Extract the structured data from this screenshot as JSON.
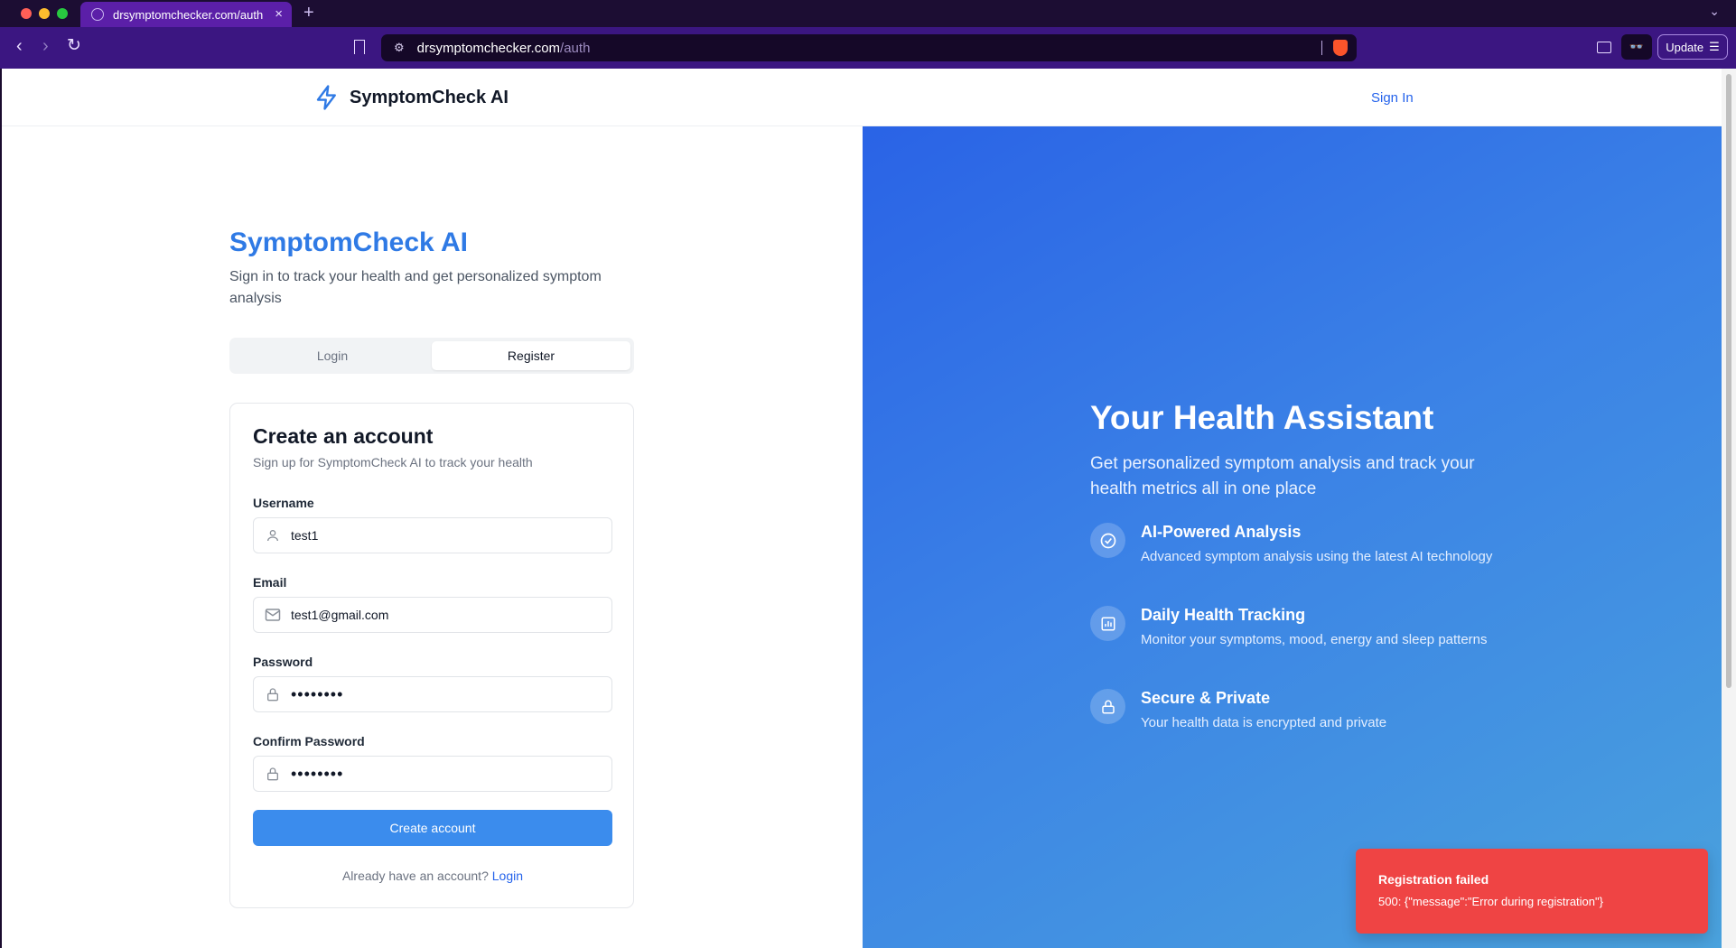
{
  "browser": {
    "tab_title": "drsymptomchecker.com/auth",
    "url_host": "drsymptomchecker.com",
    "url_path": "/auth",
    "update_label": "Update"
  },
  "header": {
    "brand_name": "SymptomCheck AI",
    "sign_in_label": "Sign In"
  },
  "hero": {
    "title": "SymptomCheck AI",
    "subtitle": "Sign in to track your health and get personalized symptom analysis"
  },
  "tabs": {
    "login_label": "Login",
    "register_label": "Register",
    "active": "Register"
  },
  "form": {
    "title": "Create an account",
    "subtitle": "Sign up for SymptomCheck AI to track your health",
    "username_label": "Username",
    "username_value": "test1",
    "email_label": "Email",
    "email_value": "test1@gmail.com",
    "password_label": "Password",
    "password_value": "••••••••",
    "confirm_label": "Confirm Password",
    "confirm_value": "••••••••",
    "submit_label": "Create account",
    "switch_prompt": "Already have an account?",
    "switch_link": "Login"
  },
  "promo": {
    "title": "Your Health Assistant",
    "subtitle": "Get personalized symptom analysis and track your health metrics all in one place",
    "features": [
      {
        "title": "AI-Powered Analysis",
        "description": "Advanced symptom analysis using the latest AI technology",
        "icon": "check-circle-icon"
      },
      {
        "title": "Daily Health Tracking",
        "description": "Monitor your symptoms, mood, energy and sleep patterns",
        "icon": "chart-icon"
      },
      {
        "title": "Secure & Private",
        "description": "Your health data is encrypted and private",
        "icon": "lock-icon"
      }
    ]
  },
  "toast": {
    "title": "Registration failed",
    "message": "500: {\"message\":\"Error during registration\"}"
  },
  "colors": {
    "accent": "#2563eb",
    "button": "#3b8ced",
    "error": "#ef4444"
  }
}
